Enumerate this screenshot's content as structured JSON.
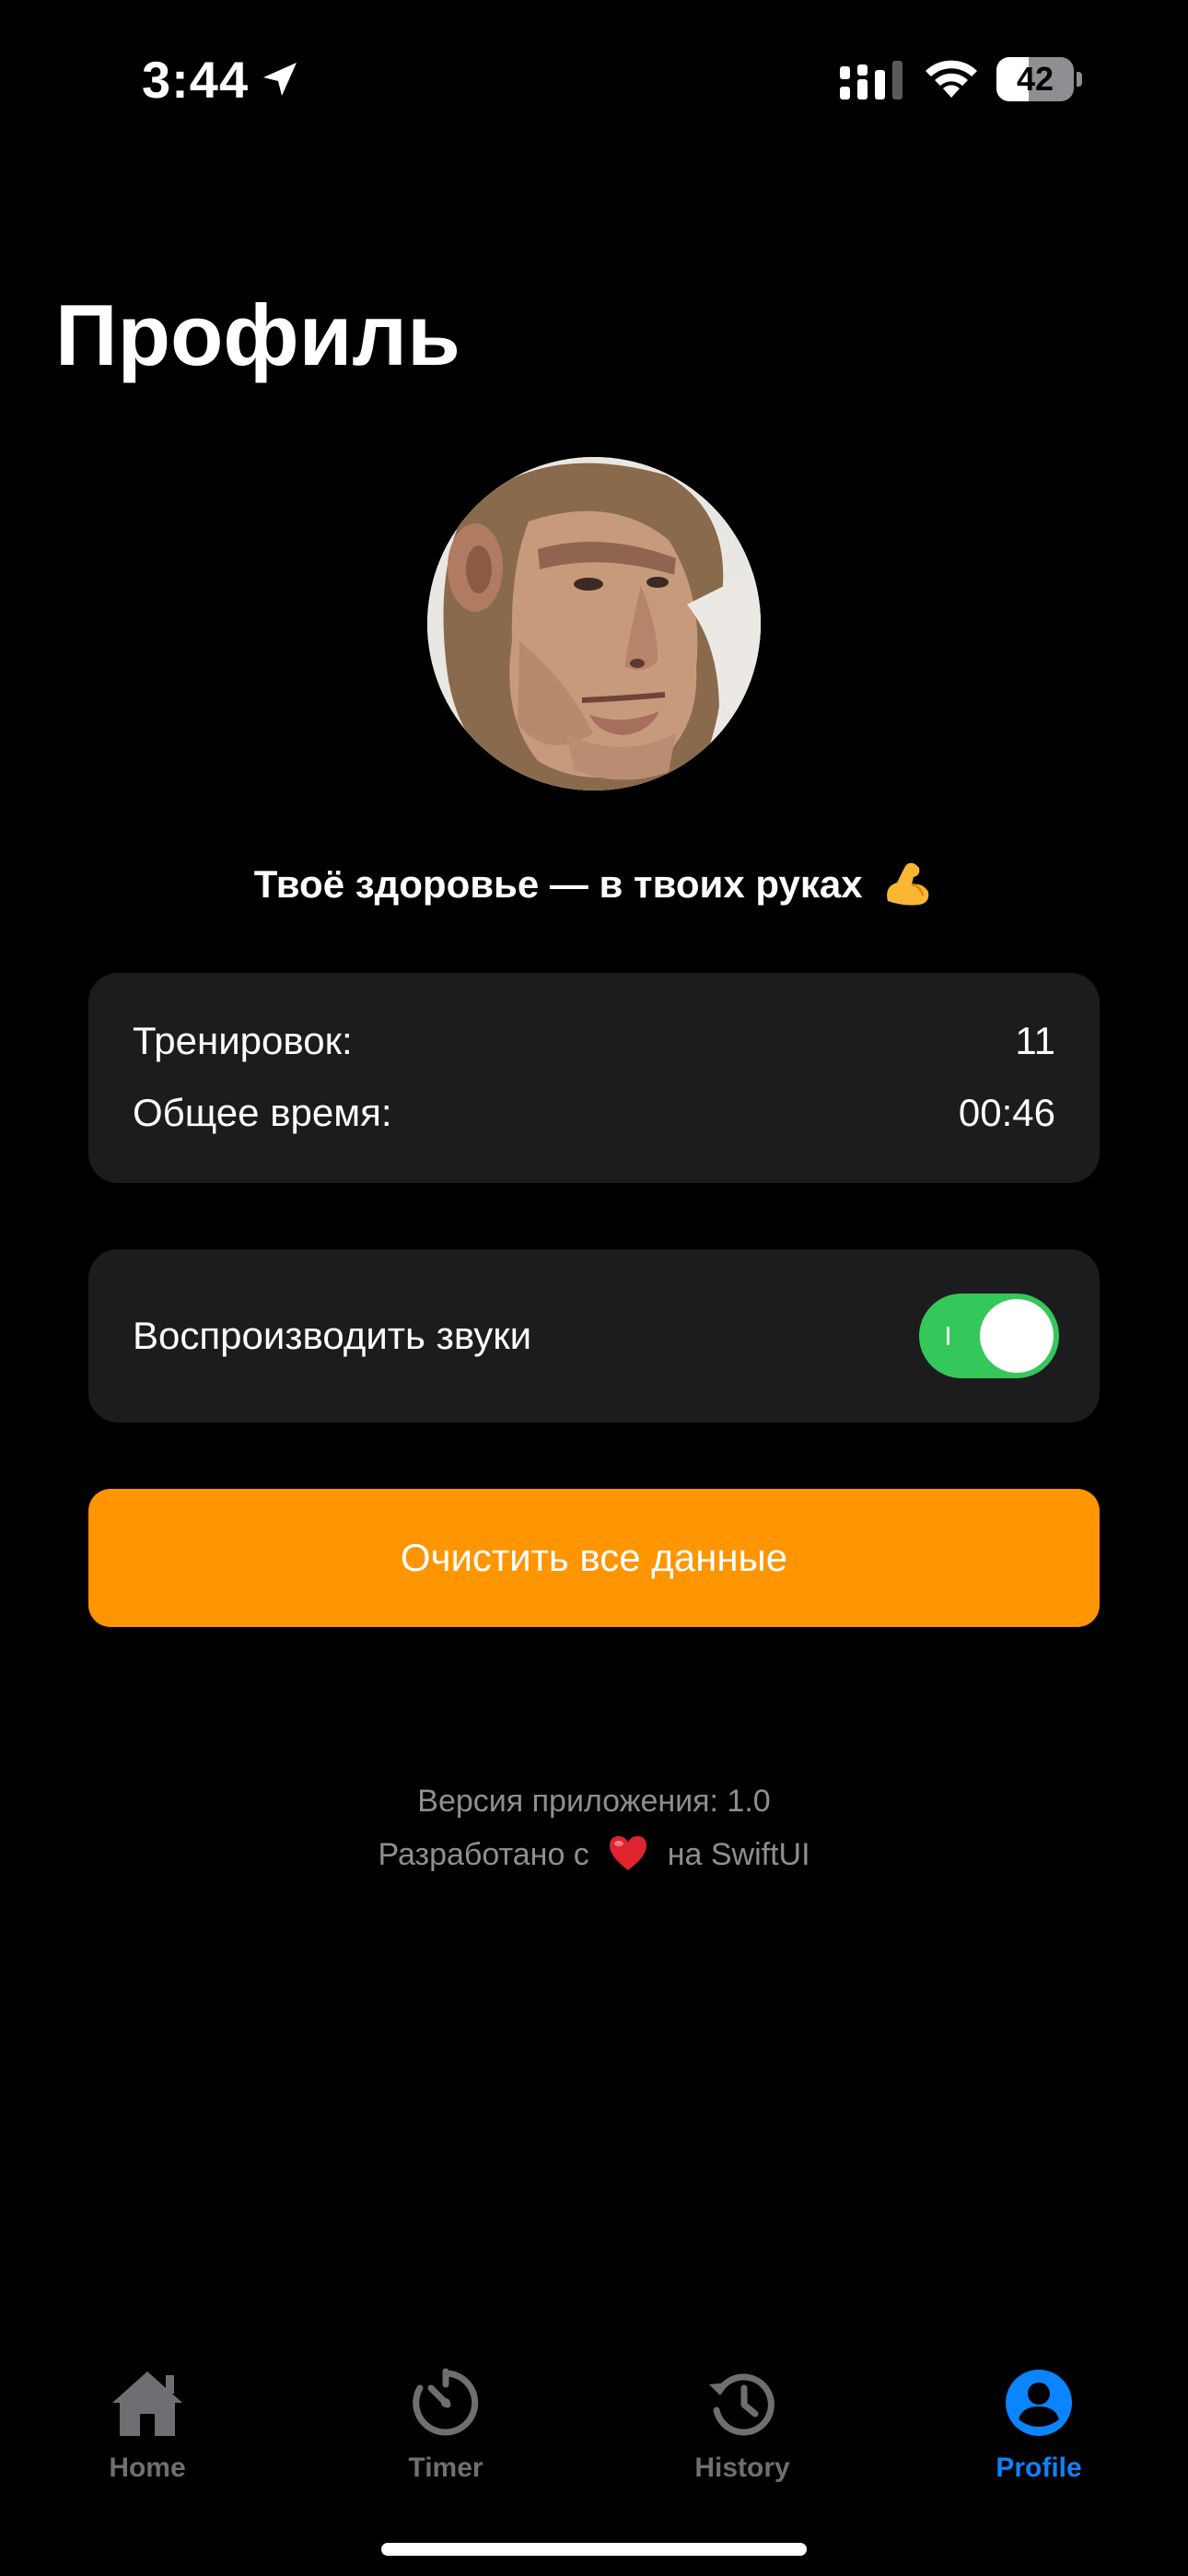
{
  "status_bar": {
    "time": "3:44",
    "battery": "42"
  },
  "page": {
    "title": "Профиль",
    "motto": "Твоё здоровье — в твоих руках"
  },
  "stats": {
    "workouts_label": "Тренировок:",
    "workouts_value": "11",
    "total_time_label": "Общее время:",
    "total_time_value": "00:46"
  },
  "settings": {
    "sound_label": "Воспроизводить звуки",
    "sound_enabled": true
  },
  "actions": {
    "clear_label": "Очистить все данные"
  },
  "footer": {
    "version": "Версия приложения: 1.0",
    "made_prefix": "Разработано с",
    "made_suffix": "на SwiftUI"
  },
  "tabs": [
    {
      "label": "Home",
      "icon": "house-icon",
      "active": false
    },
    {
      "label": "Timer",
      "icon": "timer-icon",
      "active": false
    },
    {
      "label": "History",
      "icon": "history-icon",
      "active": false
    },
    {
      "label": "Profile",
      "icon": "person-circle-icon",
      "active": true
    }
  ],
  "colors": {
    "background": "#000000",
    "card": "#1c1c1e",
    "accent_orange": "#ff9500",
    "toggle_green": "#34c759",
    "active_tab": "#0a84ff",
    "inactive_tab": "#6e6e73"
  }
}
